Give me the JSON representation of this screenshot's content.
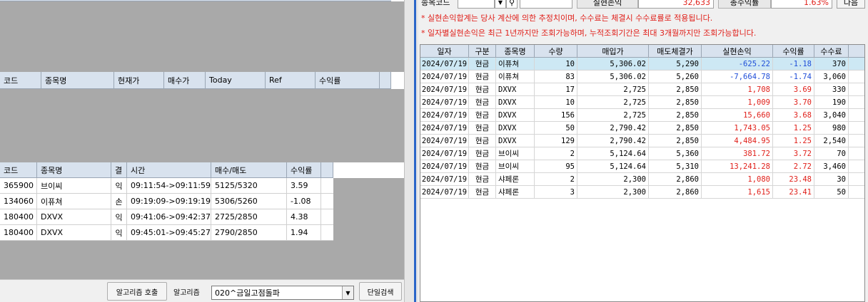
{
  "left": {
    "top_grid": {
      "headers": [
        "",
        "",
        "",
        "",
        "",
        "",
        "",
        ""
      ]
    },
    "watch_grid": {
      "headers": [
        "코드",
        "종목명",
        "현재가",
        "매수가",
        "Today",
        "Ref",
        "수익률"
      ]
    },
    "trades": {
      "headers": [
        "코드",
        "종목명",
        "결",
        "시간",
        "매수/매도",
        "수익률"
      ],
      "rows": [
        {
          "code": "365900",
          "name": "브이씨",
          "result": "익",
          "time": "09:11:54->09:11:59",
          "price": "5125/5320",
          "ret": "3.59"
        },
        {
          "code": "134060",
          "name": "이퓨쳐",
          "result": "손",
          "time": "09:19:09->09:19:19",
          "price": "5306/5260",
          "ret": "-1.08"
        },
        {
          "code": "180400",
          "name": "DXVX",
          "result": "익",
          "time": "09:41:06->09:42:37",
          "price": "2725/2850",
          "ret": "4.38"
        },
        {
          "code": "180400",
          "name": "DXVX",
          "result": "익",
          "time": "09:45:01->09:45:27",
          "price": "2790/2850",
          "ret": "1.94"
        }
      ]
    },
    "bottom": {
      "algo_call_button": "알고리즘 호출",
      "algo_label": "알고리즘",
      "algo_select_value": "020^금일고점돌파",
      "single_search_button": "단일검색"
    }
  },
  "right": {
    "topstrip": {
      "code_label": "종목코드",
      "realized_label": "실현손익",
      "realized_value": "32,633",
      "total_return_label": "총수익률",
      "total_return_value": "1.63%",
      "next_button": "다음"
    },
    "notice1": "* 실현손익합계는 당사 계산에 의한 추정치이며, 수수료는 체결시 수수료률로 적용됩니다.",
    "notice2": "* 일자별실현손익은 최근 1년까지만 조회가능하며, 누적조회기간은 최대 3개월까지만 조회가능합니다.",
    "table": {
      "headers": [
        "일자",
        "구분",
        "종목명",
        "수량",
        "매입가",
        "매도체결가",
        "실현손익",
        "수익률",
        "수수료"
      ],
      "rows": [
        {
          "date": "2024/07/19",
          "type": "현금",
          "name": "이퓨쳐",
          "qty": "10",
          "buy": "5,306.02",
          "sell": "5,290",
          "pnl": "-625.22",
          "ret": "-1.18",
          "fee": "370"
        },
        {
          "date": "2024/07/19",
          "type": "현금",
          "name": "이퓨쳐",
          "qty": "83",
          "buy": "5,306.02",
          "sell": "5,260",
          "pnl": "-7,664.78",
          "ret": "-1.74",
          "fee": "3,060"
        },
        {
          "date": "2024/07/19",
          "type": "현금",
          "name": "DXVX",
          "qty": "17",
          "buy": "2,725",
          "sell": "2,850",
          "pnl": "1,708",
          "ret": "3.69",
          "fee": "330"
        },
        {
          "date": "2024/07/19",
          "type": "현금",
          "name": "DXVX",
          "qty": "10",
          "buy": "2,725",
          "sell": "2,850",
          "pnl": "1,009",
          "ret": "3.70",
          "fee": "190"
        },
        {
          "date": "2024/07/19",
          "type": "현금",
          "name": "DXVX",
          "qty": "156",
          "buy": "2,725",
          "sell": "2,850",
          "pnl": "15,660",
          "ret": "3.68",
          "fee": "3,040"
        },
        {
          "date": "2024/07/19",
          "type": "현금",
          "name": "DXVX",
          "qty": "50",
          "buy": "2,790.42",
          "sell": "2,850",
          "pnl": "1,743.05",
          "ret": "1.25",
          "fee": "980"
        },
        {
          "date": "2024/07/19",
          "type": "현금",
          "name": "DXVX",
          "qty": "129",
          "buy": "2,790.42",
          "sell": "2,850",
          "pnl": "4,484.95",
          "ret": "1.25",
          "fee": "2,540"
        },
        {
          "date": "2024/07/19",
          "type": "현금",
          "name": "브이씨",
          "qty": "2",
          "buy": "5,124.64",
          "sell": "5,360",
          "pnl": "381.72",
          "ret": "3.72",
          "fee": "70"
        },
        {
          "date": "2024/07/19",
          "type": "현금",
          "name": "브이씨",
          "qty": "95",
          "buy": "5,124.64",
          "sell": "5,310",
          "pnl": "13,241.28",
          "ret": "2.72",
          "fee": "3,460"
        },
        {
          "date": "2024/07/19",
          "type": "현금",
          "name": "샤페론",
          "qty": "2",
          "buy": "2,300",
          "sell": "2,860",
          "pnl": "1,080",
          "ret": "23.48",
          "fee": "30"
        },
        {
          "date": "2024/07/19",
          "type": "현금",
          "name": "샤페론",
          "qty": "3",
          "buy": "2,300",
          "sell": "2,860",
          "pnl": "1,615",
          "ret": "23.41",
          "fee": "50"
        }
      ]
    }
  },
  "colors": {
    "header_bg": "#d8e2ee",
    "panel_gray": "#a9a9a9",
    "loss_blue": "#1f4ed8",
    "profit_red": "#e0201a",
    "selected_row": "#cde8f4",
    "splitter_blue": "#2b66c9"
  }
}
